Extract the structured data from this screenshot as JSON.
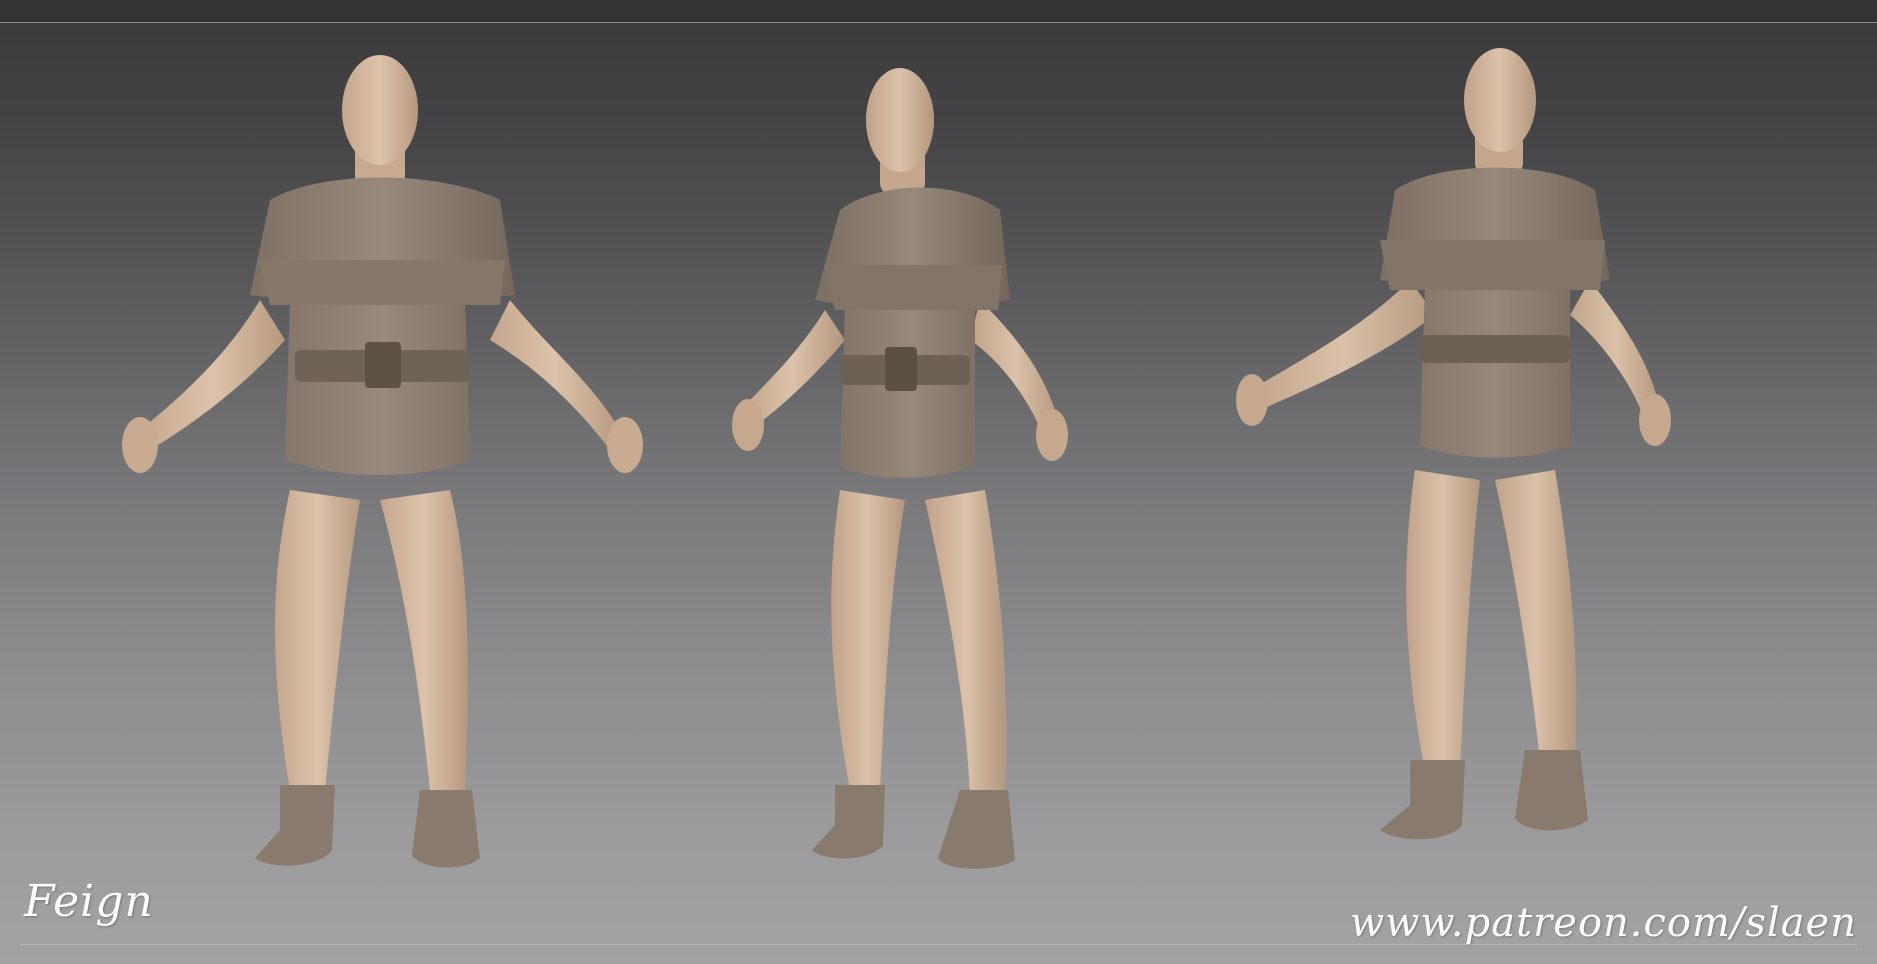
{
  "artwork": {
    "signature": "Feign",
    "watermark_url": "www.patreon.com/slaen",
    "views": [
      "front",
      "three-quarter",
      "back"
    ],
    "colors": {
      "background_top": "#3a3a3c",
      "background_bottom": "#a3a3a5",
      "skin": "#d2b59c",
      "clothing": "#8b7d70",
      "text": "#ffffff"
    }
  }
}
